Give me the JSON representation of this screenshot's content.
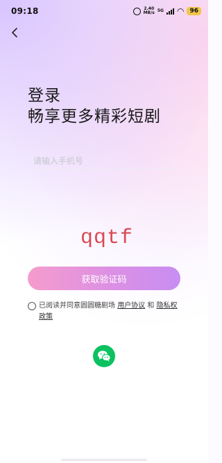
{
  "status_bar": {
    "time": "09:18",
    "net_speed_value": "2.40",
    "net_speed_unit": "MB/s",
    "network": "5G",
    "battery": "96"
  },
  "header": {
    "back_icon": "chevron-left-icon"
  },
  "title": {
    "line1": "登录",
    "line2": "畅享更多精彩短剧"
  },
  "phone_input": {
    "placeholder": "请输入手机号",
    "value": ""
  },
  "captcha": {
    "text": "qqtf"
  },
  "get_code_button": {
    "label": "获取验证码"
  },
  "agreement": {
    "checked": false,
    "prefix": "已阅读并同意圆圆糖剧场",
    "user_agreement": "用户协议",
    "and": "和",
    "privacy_policy": "隐私权政策"
  },
  "social_login": {
    "wechat_icon": "wechat-icon"
  },
  "colors": {
    "button_start": "#f59ccd",
    "button_end": "#c78ef2",
    "captcha": "#d84a55",
    "wechat": "#0bc160"
  }
}
